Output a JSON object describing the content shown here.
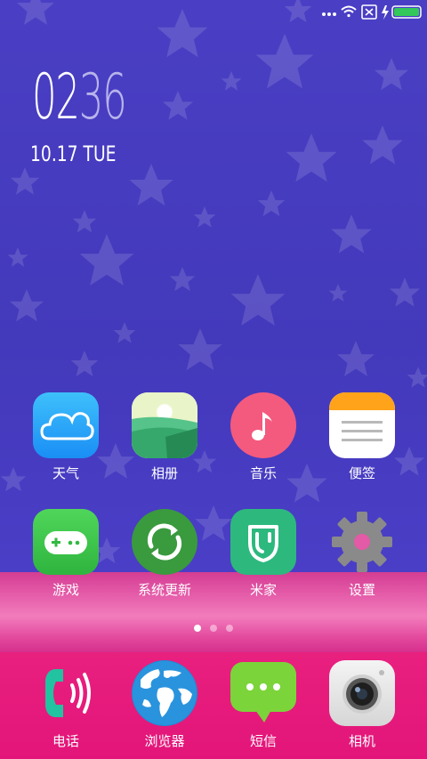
{
  "status_bar": {
    "icons": [
      "more-dots-icon",
      "wifi-icon",
      "no-sim-icon",
      "charging-icon",
      "battery-icon"
    ],
    "battery_color": "#34c759"
  },
  "clock": {
    "hours": "02",
    "minutes": "36",
    "date": "10.17 TUE"
  },
  "apps": [
    {
      "label": "天气",
      "icon": "weather-icon"
    },
    {
      "label": "相册",
      "icon": "gallery-icon"
    },
    {
      "label": "音乐",
      "icon": "music-icon"
    },
    {
      "label": "便签",
      "icon": "notes-icon"
    },
    {
      "label": "游戏",
      "icon": "games-icon"
    },
    {
      "label": "系统更新",
      "icon": "system-update-icon"
    },
    {
      "label": "米家",
      "icon": "mijia-icon"
    },
    {
      "label": "设置",
      "icon": "settings-icon"
    }
  ],
  "page_indicator": {
    "pages": 3,
    "current": 1
  },
  "dock": [
    {
      "label": "电话",
      "icon": "phone-icon"
    },
    {
      "label": "浏览器",
      "icon": "browser-icon"
    },
    {
      "label": "短信",
      "icon": "messages-icon"
    },
    {
      "label": "相机",
      "icon": "camera-icon"
    }
  ],
  "colors": {
    "background": "#4a3fc4",
    "dock": "#e3157a",
    "pink_band": "#f27cbc"
  }
}
